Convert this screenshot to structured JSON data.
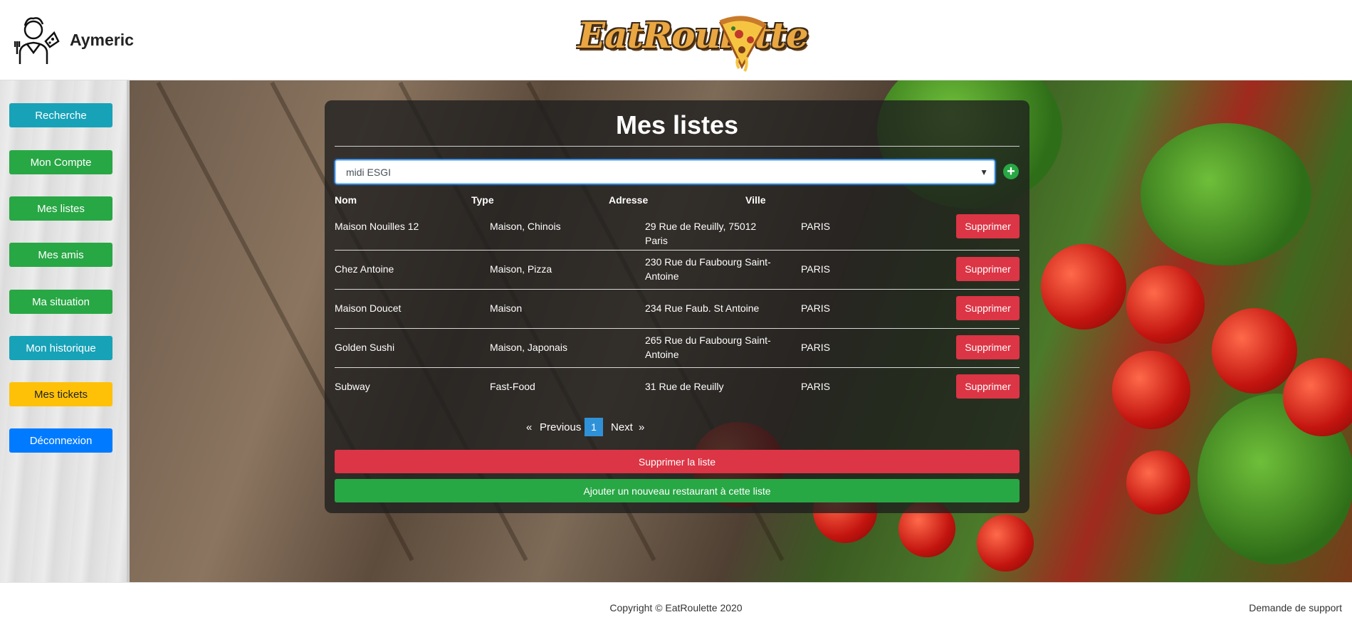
{
  "header": {
    "user_name": "Aymeric",
    "logo_text": "EatRoulette"
  },
  "sidebar": {
    "items": [
      {
        "label": "Recherche",
        "color": "#17a2b8"
      },
      {
        "label": "Mon Compte",
        "color": "#28a745"
      },
      {
        "label": "Mes listes",
        "color": "#28a745"
      },
      {
        "label": "Mes amis",
        "color": "#28a745"
      },
      {
        "label": "Ma situation",
        "color": "#28a745"
      },
      {
        "label": "Mon historique",
        "color": "#17a2b8"
      },
      {
        "label": "Mes tickets",
        "color": "#ffc107"
      },
      {
        "label": "Déconnexion",
        "color": "#007bff"
      }
    ]
  },
  "main": {
    "title": "Mes listes",
    "list_select": {
      "value": "midi ESGI"
    },
    "add_icon": "plus-circle-icon",
    "table": {
      "headers": [
        "Nom",
        "Type",
        "Adresse",
        "Ville"
      ],
      "rows": [
        {
          "nom": "Maison Nouilles 12",
          "type": "Maison, Chinois",
          "adresse": "29 Rue de Reuilly, 75012 Paris",
          "ville": "PARIS",
          "action": "Supprimer"
        },
        {
          "nom": "Chez Antoine",
          "type": "Maison, Pizza",
          "adresse": "230 Rue du Faubourg Saint-Antoine",
          "ville": "PARIS",
          "action": "Supprimer"
        },
        {
          "nom": "Maison Doucet",
          "type": "Maison",
          "adresse": "234 Rue Faub. St Antoine",
          "ville": "PARIS",
          "action": "Supprimer"
        },
        {
          "nom": "Golden Sushi",
          "type": "Maison, Japonais",
          "adresse": "265 Rue du Faubourg Saint-Antoine",
          "ville": "PARIS",
          "action": "Supprimer"
        },
        {
          "nom": "Subway",
          "type": "Fast-Food",
          "adresse": "31 Rue de Reuilly",
          "ville": "PARIS",
          "action": "Supprimer"
        }
      ]
    },
    "pagination": {
      "first": "«",
      "previous": "Previous",
      "current": "1",
      "next": "Next",
      "last": "»"
    },
    "delete_list_label": "Supprimer la liste",
    "add_restaurant_label": "Ajouter un nouveau restaurant à cette liste"
  },
  "footer": {
    "copyright": "Copyright © EatRoulette 2020",
    "support": "Demande de support"
  },
  "colors": {
    "danger": "#dc3545",
    "success": "#28a745",
    "info": "#17a2b8",
    "warning": "#ffc107",
    "primary": "#007bff"
  }
}
